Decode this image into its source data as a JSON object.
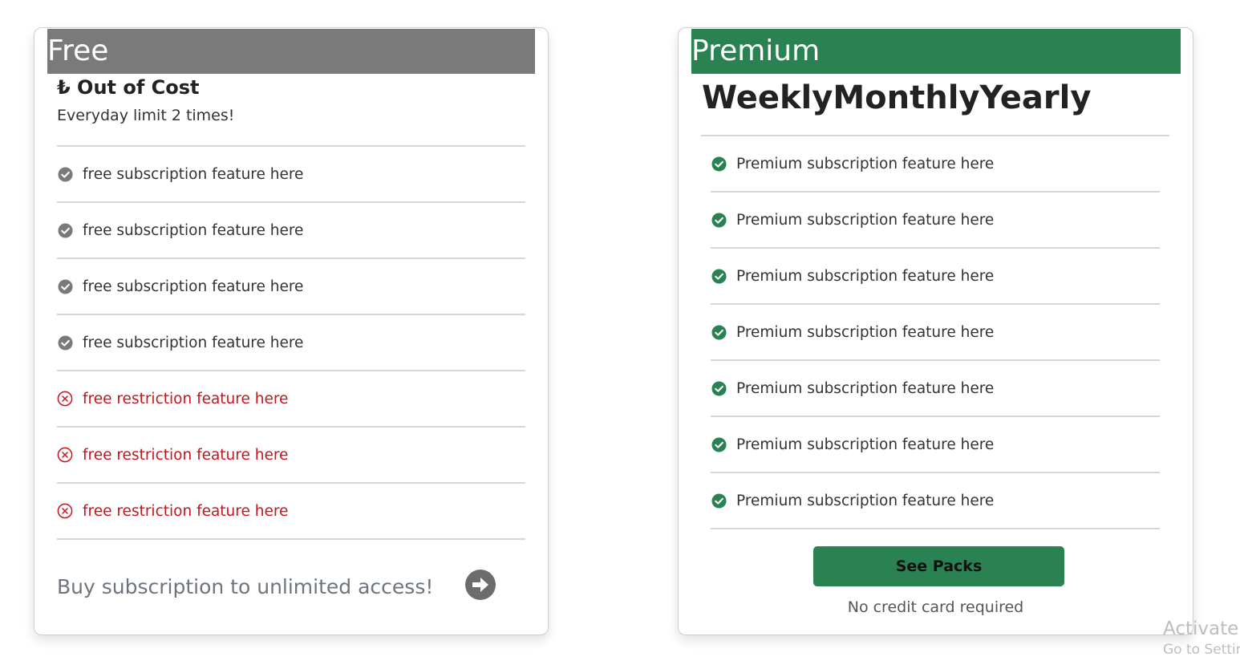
{
  "colors": {
    "free_accent": "#7a7a7a",
    "premium_accent": "#2a8152",
    "restriction": "#c8151b"
  },
  "free_plan": {
    "name": "Free",
    "price": "₺ Out of Cost",
    "limit": "Everyday limit 2 times!",
    "features": [
      "free subscription feature here",
      "free subscription feature here",
      "free subscription feature here",
      "free subscription feature here"
    ],
    "restrictions": [
      "free restriction feature here",
      "free restriction feature here",
      "free restriction feature here"
    ],
    "feature_icon": "check-circle-icon",
    "restriction_icon": "x-circle-icon",
    "cta_text": "Buy subscription to unlimited access!",
    "cta_icon": "arrow-right-circle-icon"
  },
  "premium_plan": {
    "name": "Premium",
    "periods": [
      "Weekly",
      "Monthly",
      "Yearly"
    ],
    "features": [
      "Premium subscription feature here",
      "Premium subscription feature here",
      "Premium subscription feature here",
      "Premium subscription feature here",
      "Premium subscription feature here",
      "Premium subscription feature here",
      "Premium subscription feature here"
    ],
    "feature_icon": "check-circle-icon",
    "button_label": "See Packs",
    "note": "No credit card required"
  },
  "watermark": {
    "line1": "Activate",
    "line2": "Go to Settin"
  }
}
